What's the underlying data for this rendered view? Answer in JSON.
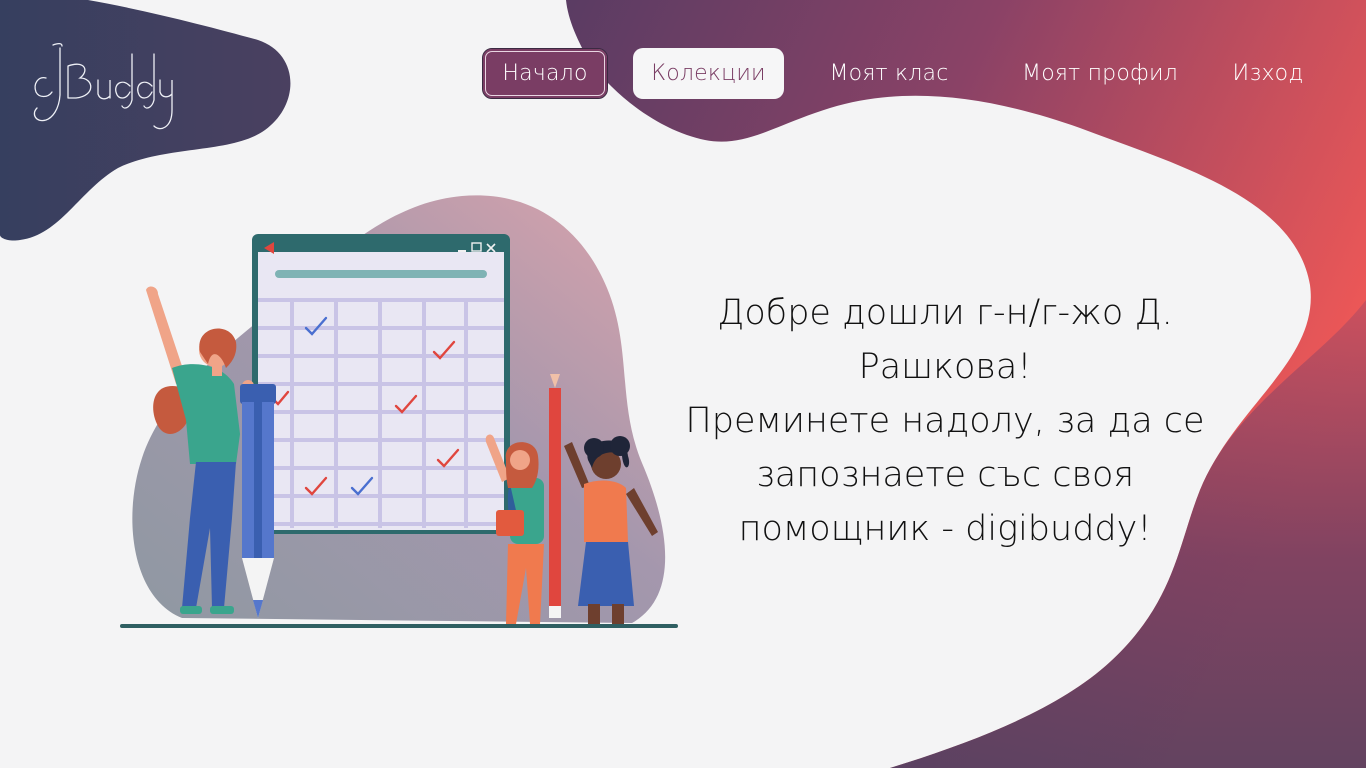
{
  "logo": {
    "text": "dBuddy"
  },
  "nav": {
    "items": [
      {
        "label": "Начало"
      },
      {
        "label": "Колекции"
      },
      {
        "label": "Моят клас"
      },
      {
        "label": "Моят профил"
      },
      {
        "label": "Изход"
      }
    ]
  },
  "welcome": {
    "line1": "Добре дошли г-н/г-жо Д. Рашкова!",
    "line2": "Преминете надолу, за да се запознаете със своя помощник - digibuddy!"
  },
  "colors": {
    "background": "#f4f4f5",
    "navy_blob": "#3b4563",
    "plum": "#6c3e62",
    "coral": "#ee5856",
    "active_nav": "#7a3d64"
  },
  "icons": [
    "logo-icon",
    "window-minimize-icon",
    "window-maximize-icon",
    "window-close-icon",
    "check-icon"
  ]
}
